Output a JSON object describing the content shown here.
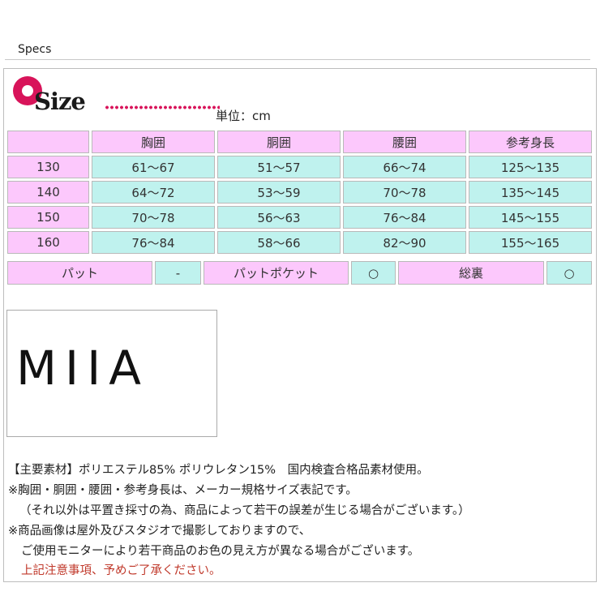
{
  "header": {
    "title": "Specs"
  },
  "size_logo": {
    "text": "Size"
  },
  "unit": "単位：cm",
  "size_table": {
    "columns": [
      "",
      "胸囲",
      "胴囲",
      "腰囲",
      "参考身長"
    ],
    "rows": [
      [
        "130",
        "61～67",
        "51～57",
        "66～74",
        "125～135"
      ],
      [
        "140",
        "64～72",
        "53～59",
        "70～78",
        "135～145"
      ],
      [
        "150",
        "70～78",
        "56～63",
        "76～84",
        "145～155"
      ],
      [
        "160",
        "76～84",
        "58～66",
        "82～90",
        "155～165"
      ]
    ]
  },
  "features": [
    {
      "label": "パット",
      "value": "-"
    },
    {
      "label": "パットポケット",
      "value": "○"
    },
    {
      "label": "総裏",
      "value": "○"
    }
  ],
  "brand": {
    "logo_text": "MIIA"
  },
  "notes": [
    "【主要素材】ポリエステル85% ポリウレタン15%　国内検査合格品素材使用。",
    "※胸囲・胴囲・腰囲・参考身長は、メーカー規格サイズ表記です。",
    "（それ以外は平置き採寸の為、商品によって若干の誤差が生じる場合がございます。）",
    "※商品画像は屋外及びスタジオで撮影しておりますので、",
    "ご使用モニターにより若干商品のお色の見え方が異なる場合がございます。",
    "上記注意事項、予めご了承ください。"
  ],
  "colors": {
    "header_cell": "#fcc8fc",
    "value_cell": "#bff2ee",
    "accent": "#d8145a",
    "warning_text": "#c0392b"
  }
}
